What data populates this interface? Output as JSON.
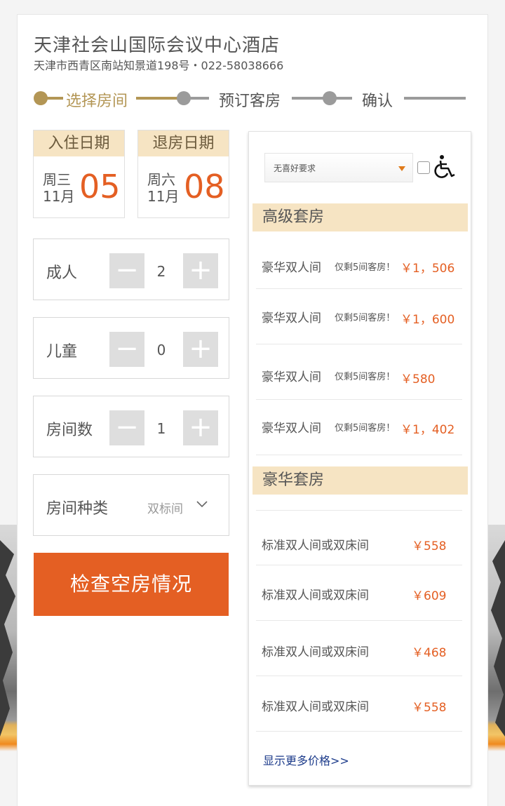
{
  "hotel": {
    "name": "天津社会山国际会议中心酒店",
    "address": "天津市西青区南站知景道198号・022-58038666"
  },
  "steps": [
    {
      "label": "选择房间",
      "active": true
    },
    {
      "label": "预订客房",
      "active": false
    },
    {
      "label": "确认",
      "active": false
    }
  ],
  "checkin": {
    "title": "入住日期",
    "weekday": "周三",
    "month": "11月",
    "day": "05"
  },
  "checkout": {
    "title": "退房日期",
    "weekday": "周六",
    "month": "11月",
    "day": "08"
  },
  "adults": {
    "label": "成人",
    "value": "2",
    "minus": "−",
    "plus": "+"
  },
  "children": {
    "label": "儿童",
    "value": "0",
    "minus": "−",
    "plus": "+"
  },
  "rooms": {
    "label": "房间数",
    "value": "1",
    "minus": "−",
    "plus": "+"
  },
  "room_type": {
    "label": "房间种类",
    "value": "双标间"
  },
  "check_button": "检查空房情况",
  "panel": {
    "preference": "无喜好要求",
    "categories": [
      {
        "title": "高级套房",
        "rows": [
          {
            "name": "豪华双人间",
            "note": "仅剩5间客房！",
            "price": "￥1，506"
          },
          {
            "name": "豪华双人间",
            "note": "仅剩5间客房！",
            "price": "￥1，600"
          },
          {
            "name": "豪华双人间",
            "note": "仅剩5间客房！",
            "price": "￥580"
          },
          {
            "name": "豪华双人间",
            "note": "仅剩5间客房！",
            "price": "￥1，402"
          }
        ]
      },
      {
        "title": "豪华套房",
        "rows": [
          {
            "name": "标准双人间或双床间",
            "price": "￥558"
          },
          {
            "name": "标准双人间或双床间",
            "price": "￥609"
          },
          {
            "name": "标准双人间或双床间",
            "price": "￥468"
          },
          {
            "name": "标准双人间或双床间",
            "price": "￥558"
          }
        ]
      }
    ],
    "more_link": "显示更多价格>>"
  },
  "colors": {
    "accent": "#e45f23",
    "step_active": "#b39655",
    "step_inactive": "#9b9b9b",
    "header_bg": "#f6e4c3"
  }
}
